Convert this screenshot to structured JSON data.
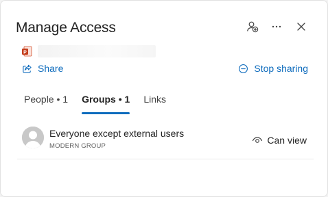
{
  "dialog": {
    "title": "Manage Access",
    "header_icons": [
      "person-add-icon",
      "more-icon",
      "close-icon"
    ]
  },
  "file": {
    "icon": "powerpoint-file-icon",
    "name": ""
  },
  "actions": {
    "share_label": "Share",
    "stop_sharing_label": "Stop sharing"
  },
  "tabs": [
    {
      "label": "People • 1",
      "active": false
    },
    {
      "label": "Groups • 1",
      "active": true
    },
    {
      "label": "Links",
      "active": false
    }
  ],
  "members": [
    {
      "name": "Everyone except external users",
      "type": "MODERN GROUP",
      "permission": "Can view",
      "avatar_icon": "group-avatar-icon",
      "permission_icon": "eye-icon"
    }
  ],
  "colors": {
    "accent": "#0f6cbd",
    "text": "#242424",
    "powerpoint": "#c43e1c"
  }
}
